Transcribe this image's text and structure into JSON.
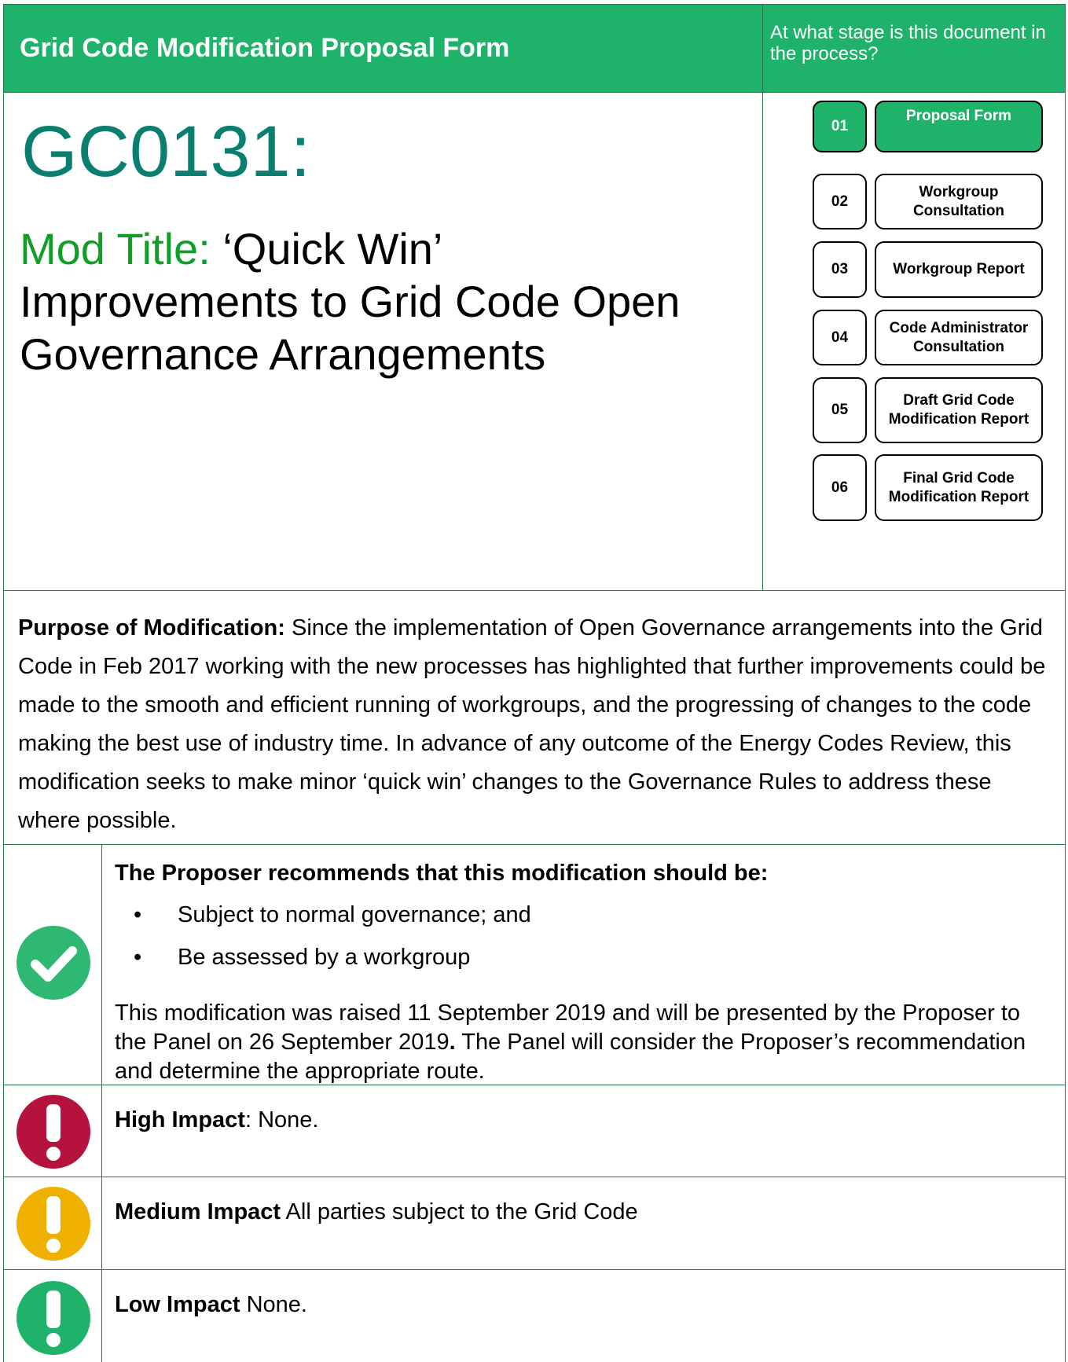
{
  "header": {
    "title": "Grid Code Modification Proposal Form",
    "stage_question": "At what stage is this document in the process?"
  },
  "title_block": {
    "code": "GC0131:",
    "mod_label": "Mod Title:",
    "mod_title": " ‘Quick Win’ Improvements to Grid Code Open Governance Arrangements"
  },
  "stages": [
    {
      "num": "01",
      "label": "Proposal Form",
      "active": true
    },
    {
      "num": "02",
      "label": "Workgroup Consultation",
      "active": false
    },
    {
      "num": "03",
      "label": "Workgroup Report",
      "active": false
    },
    {
      "num": "04",
      "label": "Code Administrator Consultation",
      "active": false
    },
    {
      "num": "05",
      "label": "Draft Grid Code Modification Report",
      "active": false
    },
    {
      "num": "06",
      "label": "Final Grid Code Modification Report",
      "active": false
    }
  ],
  "purpose": {
    "label": "Purpose of Modification:",
    "text": "  Since the implementation of Open Governance arrangements into the Grid Code in Feb 2017 working with the new processes has highlighted that further improvements could be made to the smooth and efficient running of workgroups, and the progressing of changes to the code making the best use of industry time. In advance of any outcome of the Energy Codes Review, this modification seeks to make minor ‘quick win’ changes to the Governance Rules to address these where possible."
  },
  "recommendation": {
    "heading": "The Proposer recommends that this modification should be:",
    "bullets": [
      "Subject to normal governance; and",
      "Be assessed by a workgroup"
    ],
    "note_1": "This modification was raised 11 September 2019 and will be presented by the Proposer to the Panel on 26 September 2019",
    "note_dot": ".",
    "note_2": "  The Panel will consider the Proposer’s recommendation and determine the appropriate route."
  },
  "impacts": {
    "high": {
      "label": "High Impact",
      "text": ": None.",
      "color": "#b5123e"
    },
    "medium": {
      "label": "Medium Impact",
      "text": " All parties subject to the Grid Code",
      "color": "#f0b000"
    },
    "low": {
      "label": "Low Impact",
      "text": " None.",
      "color": "#1fb26b"
    }
  },
  "colors": {
    "brand_green": "#1fb26b",
    "title_teal": "#0a7f70",
    "mod_label_green": "#109d28",
    "check_green": "#2eb872"
  }
}
